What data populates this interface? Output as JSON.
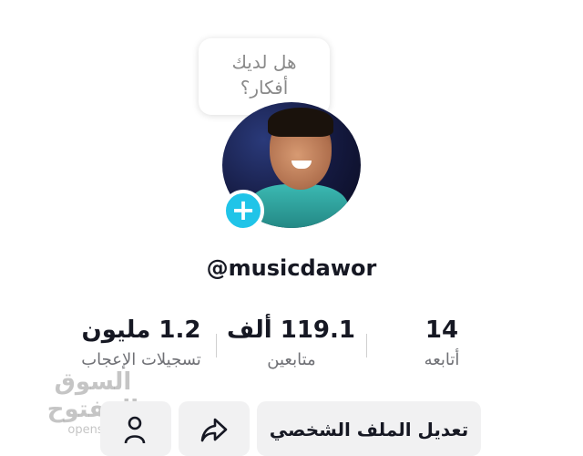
{
  "topbar": {
    "partial_text": "؛"
  },
  "bubble": {
    "line1": "هل لديك",
    "line2": "أفكار؟"
  },
  "profile": {
    "username": "@musicdawor"
  },
  "stats": {
    "likes": {
      "value": "1.2 مليون",
      "label": "تسجيلات الإعجاب"
    },
    "followers": {
      "value": "119.1 ألف",
      "label": "متابعين"
    },
    "following": {
      "value": "14",
      "label": "أتابعه"
    }
  },
  "buttons": {
    "edit_profile": "تعديل الملف الشخصي"
  },
  "watermark": {
    "arabic": "السوق المفتوح",
    "latin": "opensooq.com"
  },
  "colors": {
    "accent": "#20c4e8",
    "text": "#161823",
    "secondary_text": "#6f7075",
    "button_bg": "#f1f1f2"
  }
}
